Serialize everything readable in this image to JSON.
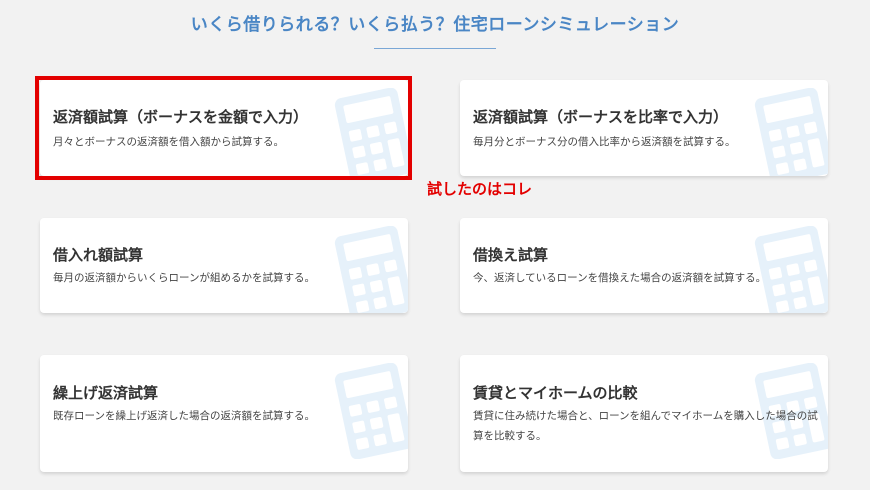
{
  "header": {
    "title": "いくら借りられる？いくら払う？住宅ローンシミュレーション"
  },
  "cards": [
    {
      "title": "返済額試算（ボーナスを金額で入力）",
      "desc": "月々とボーナスの返済額を借入額から試算する。",
      "icon": "calculator-icon"
    },
    {
      "title": "返済額試算（ボーナスを比率で入力）",
      "desc": "毎月分とボーナス分の借入比率から返済額を試算する。",
      "icon": "calculator-icon"
    },
    {
      "title": "借入れ額試算",
      "desc": "毎月の返済額からいくらローンが組めるかを試算する。",
      "icon": "calculator-icon"
    },
    {
      "title": "借換え試算",
      "desc": "今、返済しているローンを借換えた場合の返済額を試算する。",
      "icon": "calculator-icon"
    },
    {
      "title": "繰上げ返済試算",
      "desc": "既存ローンを繰上げ返済した場合の返済額を試算する。",
      "icon": "calculator-icon"
    },
    {
      "title": "賃貸とマイホームの比較",
      "desc": "賃貸に住み続けた場合と、ローンを組んでマイホームを購入した場合の試算を比較する。",
      "icon": "calculator-icon"
    }
  ],
  "annotation": {
    "text": "試したのはコレ"
  },
  "colors": {
    "accent": "#4a86c5",
    "highlight": "#e30000",
    "icon": "#e6f1fa"
  }
}
